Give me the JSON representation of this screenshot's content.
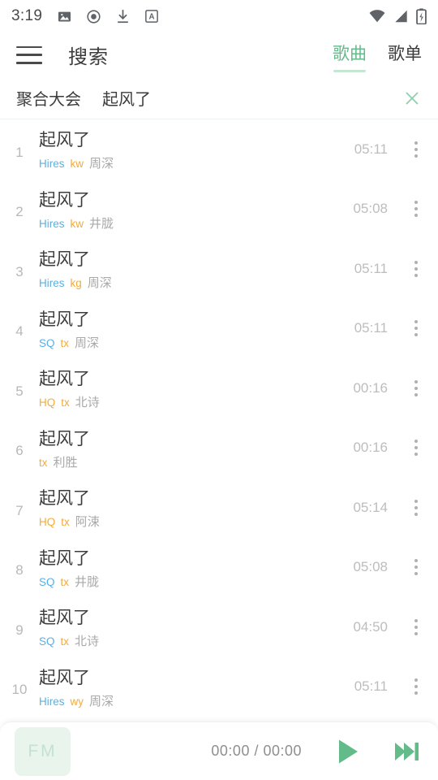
{
  "status_bar": {
    "time": "3:19",
    "left_icons": [
      "image-icon",
      "record-icon",
      "download-icon",
      "screenshot-a-icon"
    ],
    "right_icons": [
      "wifi-icon",
      "signal-icon",
      "battery-charging-icon"
    ]
  },
  "app_bar": {
    "menu_icon": "hamburger-menu-icon",
    "title": "搜索",
    "tabs": [
      {
        "label": "歌曲",
        "active": true
      },
      {
        "label": "歌单",
        "active": false
      }
    ]
  },
  "query_row": {
    "source_label": "聚合大会",
    "keyword": "起风了",
    "close_icon": "close-icon"
  },
  "songs": [
    {
      "index": "1",
      "title": "起风了",
      "quality": "Hires",
      "quality_kind": "hires",
      "source": "kw",
      "artist": "周深",
      "duration": "05:11"
    },
    {
      "index": "2",
      "title": "起风了",
      "quality": "Hires",
      "quality_kind": "hires",
      "source": "kw",
      "artist": "井胧",
      "duration": "05:08"
    },
    {
      "index": "3",
      "title": "起风了",
      "quality": "Hires",
      "quality_kind": "hires",
      "source": "kg",
      "artist": "周深",
      "duration": "05:11"
    },
    {
      "index": "4",
      "title": "起风了",
      "quality": "SQ",
      "quality_kind": "sq",
      "source": "tx",
      "artist": "周深",
      "duration": "05:11"
    },
    {
      "index": "5",
      "title": "起风了",
      "quality": "HQ",
      "quality_kind": "hq",
      "source": "tx",
      "artist": "北诗",
      "duration": "00:16"
    },
    {
      "index": "6",
      "title": "起风了",
      "quality": "",
      "quality_kind": "none",
      "source": "tx",
      "artist": "利胜",
      "duration": "00:16"
    },
    {
      "index": "7",
      "title": "起风了",
      "quality": "HQ",
      "quality_kind": "hq",
      "source": "tx",
      "artist": "阿涑",
      "duration": "05:14"
    },
    {
      "index": "8",
      "title": "起风了",
      "quality": "SQ",
      "quality_kind": "sq",
      "source": "tx",
      "artist": "井胧",
      "duration": "05:08"
    },
    {
      "index": "9",
      "title": "起风了",
      "quality": "SQ",
      "quality_kind": "sq",
      "source": "tx",
      "artist": "北诗",
      "duration": "04:50"
    },
    {
      "index": "10",
      "title": "起风了",
      "quality": "Hires",
      "quality_kind": "hires",
      "source": "wy",
      "artist": "周深",
      "duration": "05:11"
    }
  ],
  "player_bar": {
    "fm_label": "FM",
    "time_display": "00:00 / 00:00",
    "play_icon": "play-icon",
    "next_icon": "next-track-icon"
  },
  "colors": {
    "accent_green": "#63bb8a",
    "tab_underline": "#c6e6d4",
    "hires_blue": "#57b0e5",
    "source_orange": "#f3ab3a",
    "fm_bg": "#e9f4ed",
    "text_primary": "#3c3c3c",
    "text_muted": "#a9a9a9"
  }
}
